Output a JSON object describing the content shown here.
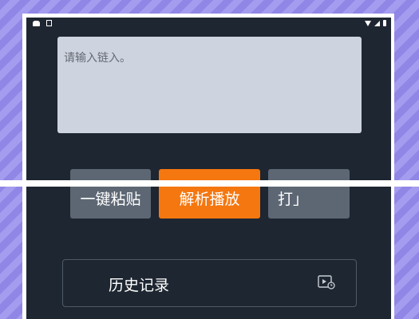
{
  "input": {
    "placeholder": "请输入链入。"
  },
  "buttons": {
    "paste_label": "一键粘贴",
    "parse_label": "解析播放",
    "open_label": "打」"
  },
  "history": {
    "label": "历史记录"
  },
  "colors": {
    "accent": "#f57710",
    "screen_bg": "#1e2631",
    "button_gray": "#5d6774",
    "input_bg": "#cdd3df"
  },
  "icons": {
    "history_icon": "play-history-icon"
  }
}
